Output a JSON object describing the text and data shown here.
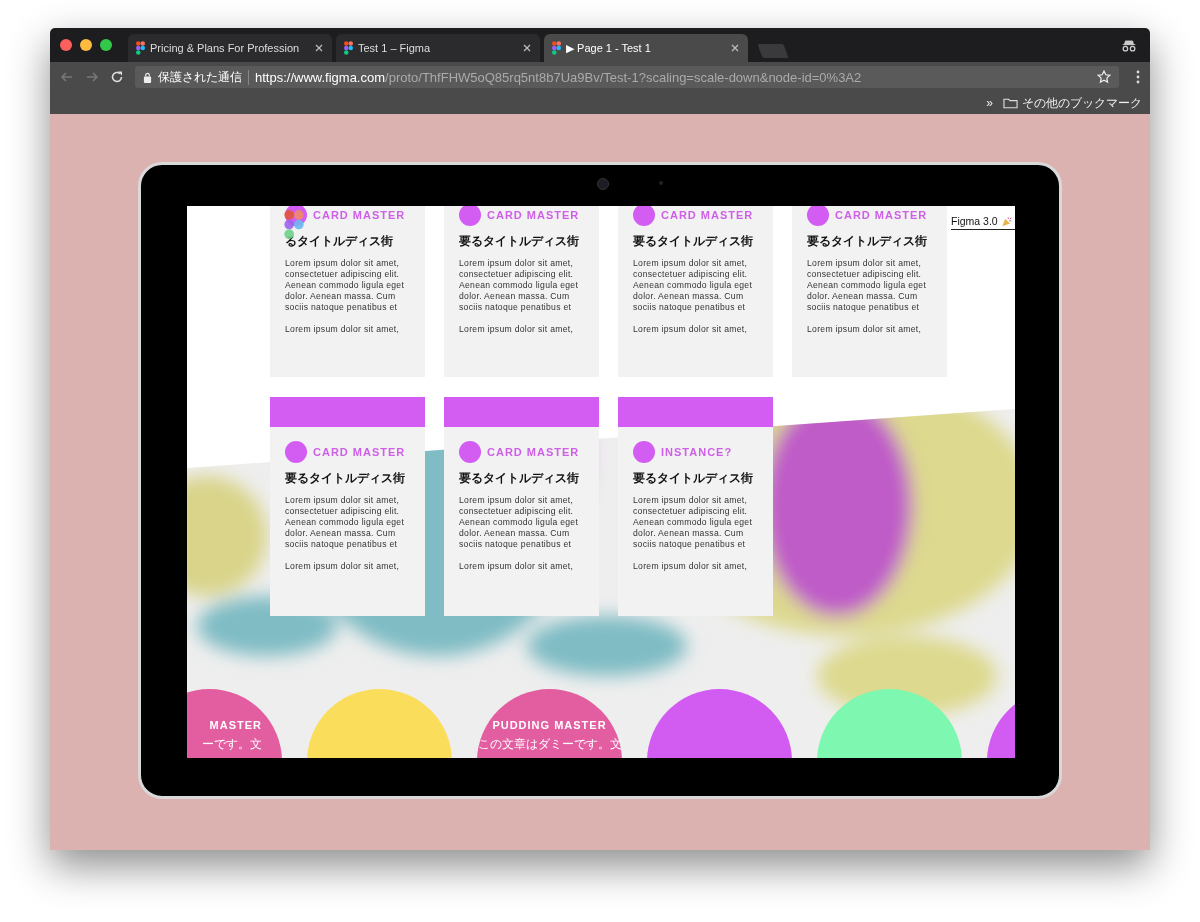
{
  "browser": {
    "tabs": [
      {
        "title": "Pricing & Plans For Profession",
        "selected": false
      },
      {
        "title": "Test 1 – Figma",
        "selected": false
      },
      {
        "title": "▶ Page 1 - Test 1",
        "selected": true
      }
    ],
    "address": {
      "secure_label": "保護された通信",
      "url_host": "https://www.figma.com",
      "url_path": "/proto/ThfFHW5oQ85rq5nt8b7Ua9Bv/Test-1?scaling=scale-down&node-id=0%3A2"
    },
    "bookmarks_more": "»",
    "bookmarks": [
      "その他のブックマーク"
    ]
  },
  "prototype": {
    "badge": "Figma 3.0",
    "card_rows": [
      [
        {
          "kind": "plain",
          "title": "CARD MASTER",
          "subtitle": "るタイトルディス街",
          "paragraphs": [
            "Lorem ipsum dolor sit amet, consectetuer adipiscing elit. Aenean commodo ligula eget dolor. Aenean massa. Cum sociis natoque penatibus et",
            "Lorem ipsum dolor sit amet,"
          ]
        },
        {
          "kind": "plain",
          "title": "CARD MASTER",
          "subtitle": "要るタイトルディス街",
          "paragraphs": [
            "Lorem ipsum dolor sit amet, consectetuer adipiscing elit. Aenean commodo ligula eget dolor. Aenean massa. Cum sociis natoque penatibus et",
            "Lorem ipsum dolor sit amet,"
          ]
        },
        {
          "kind": "plain",
          "title": "CARD MASTER",
          "subtitle": "要るタイトルディス街",
          "paragraphs": [
            "Lorem ipsum dolor sit amet, consectetuer adipiscing elit. Aenean commodo ligula eget dolor. Aenean massa. Cum sociis natoque penatibus et",
            "Lorem ipsum dolor sit amet,"
          ]
        },
        {
          "kind": "plain",
          "title": "CARD MASTER",
          "subtitle": "要るタイトルディス街",
          "paragraphs": [
            "Lorem ipsum dolor sit amet, consectetuer adipiscing elit. Aenean commodo ligula eget dolor. Aenean massa. Cum sociis natoque penatibus et",
            "Lorem ipsum dolor sit amet,"
          ]
        }
      ],
      [
        {
          "kind": "header",
          "title": "CARD MASTER",
          "subtitle": "要るタイトルディス街",
          "paragraphs": [
            "Lorem ipsum dolor sit amet, consectetuer adipiscing elit. Aenean commodo ligula eget dolor. Aenean massa. Cum sociis natoque penatibus et",
            "Lorem ipsum dolor sit amet,"
          ]
        },
        {
          "kind": "header",
          "title": "CARD MASTER",
          "subtitle": "要るタイトルディス街",
          "paragraphs": [
            "Lorem ipsum dolor sit amet, consectetuer adipiscing elit. Aenean commodo ligula eget dolor. Aenean massa. Cum sociis natoque penatibus et",
            "Lorem ipsum dolor sit amet,"
          ]
        },
        {
          "kind": "header",
          "title": "INSTANCE?",
          "subtitle": "要るタイトルディス街",
          "paragraphs": [
            "Lorem ipsum dolor sit amet, consectetuer adipiscing elit. Aenean commodo ligula eget dolor. Aenean massa. Cum sociis natoque penatibus et",
            "Lorem ipsum dolor sit amet,"
          ]
        }
      ]
    ],
    "circles": [
      {
        "color": "#e35ea0",
        "title": "MASTER",
        "text": "ーです。文"
      },
      {
        "color": "#fbdd5c"
      },
      {
        "color": "#e35ea0",
        "title": "PUDDING MASTER",
        "text": "この文章はダミーです。文"
      },
      {
        "color": "#d25cf2"
      },
      {
        "color": "#7ef7b0"
      },
      {
        "color": "#d25cf2"
      }
    ]
  }
}
